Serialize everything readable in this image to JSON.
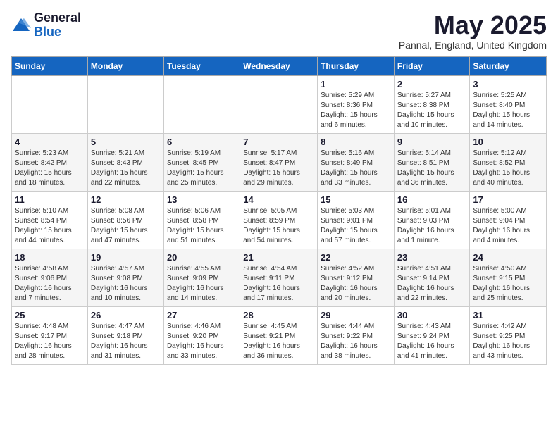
{
  "logo": {
    "general": "General",
    "blue": "Blue"
  },
  "header": {
    "month": "May 2025",
    "location": "Pannal, England, United Kingdom"
  },
  "weekdays": [
    "Sunday",
    "Monday",
    "Tuesday",
    "Wednesday",
    "Thursday",
    "Friday",
    "Saturday"
  ],
  "weeks": [
    [
      {
        "day": "",
        "info": ""
      },
      {
        "day": "",
        "info": ""
      },
      {
        "day": "",
        "info": ""
      },
      {
        "day": "",
        "info": ""
      },
      {
        "day": "1",
        "info": "Sunrise: 5:29 AM\nSunset: 8:36 PM\nDaylight: 15 hours\nand 6 minutes."
      },
      {
        "day": "2",
        "info": "Sunrise: 5:27 AM\nSunset: 8:38 PM\nDaylight: 15 hours\nand 10 minutes."
      },
      {
        "day": "3",
        "info": "Sunrise: 5:25 AM\nSunset: 8:40 PM\nDaylight: 15 hours\nand 14 minutes."
      }
    ],
    [
      {
        "day": "4",
        "info": "Sunrise: 5:23 AM\nSunset: 8:42 PM\nDaylight: 15 hours\nand 18 minutes."
      },
      {
        "day": "5",
        "info": "Sunrise: 5:21 AM\nSunset: 8:43 PM\nDaylight: 15 hours\nand 22 minutes."
      },
      {
        "day": "6",
        "info": "Sunrise: 5:19 AM\nSunset: 8:45 PM\nDaylight: 15 hours\nand 25 minutes."
      },
      {
        "day": "7",
        "info": "Sunrise: 5:17 AM\nSunset: 8:47 PM\nDaylight: 15 hours\nand 29 minutes."
      },
      {
        "day": "8",
        "info": "Sunrise: 5:16 AM\nSunset: 8:49 PM\nDaylight: 15 hours\nand 33 minutes."
      },
      {
        "day": "9",
        "info": "Sunrise: 5:14 AM\nSunset: 8:51 PM\nDaylight: 15 hours\nand 36 minutes."
      },
      {
        "day": "10",
        "info": "Sunrise: 5:12 AM\nSunset: 8:52 PM\nDaylight: 15 hours\nand 40 minutes."
      }
    ],
    [
      {
        "day": "11",
        "info": "Sunrise: 5:10 AM\nSunset: 8:54 PM\nDaylight: 15 hours\nand 44 minutes."
      },
      {
        "day": "12",
        "info": "Sunrise: 5:08 AM\nSunset: 8:56 PM\nDaylight: 15 hours\nand 47 minutes."
      },
      {
        "day": "13",
        "info": "Sunrise: 5:06 AM\nSunset: 8:58 PM\nDaylight: 15 hours\nand 51 minutes."
      },
      {
        "day": "14",
        "info": "Sunrise: 5:05 AM\nSunset: 8:59 PM\nDaylight: 15 hours\nand 54 minutes."
      },
      {
        "day": "15",
        "info": "Sunrise: 5:03 AM\nSunset: 9:01 PM\nDaylight: 15 hours\nand 57 minutes."
      },
      {
        "day": "16",
        "info": "Sunrise: 5:01 AM\nSunset: 9:03 PM\nDaylight: 16 hours\nand 1 minute."
      },
      {
        "day": "17",
        "info": "Sunrise: 5:00 AM\nSunset: 9:04 PM\nDaylight: 16 hours\nand 4 minutes."
      }
    ],
    [
      {
        "day": "18",
        "info": "Sunrise: 4:58 AM\nSunset: 9:06 PM\nDaylight: 16 hours\nand 7 minutes."
      },
      {
        "day": "19",
        "info": "Sunrise: 4:57 AM\nSunset: 9:08 PM\nDaylight: 16 hours\nand 10 minutes."
      },
      {
        "day": "20",
        "info": "Sunrise: 4:55 AM\nSunset: 9:09 PM\nDaylight: 16 hours\nand 14 minutes."
      },
      {
        "day": "21",
        "info": "Sunrise: 4:54 AM\nSunset: 9:11 PM\nDaylight: 16 hours\nand 17 minutes."
      },
      {
        "day": "22",
        "info": "Sunrise: 4:52 AM\nSunset: 9:12 PM\nDaylight: 16 hours\nand 20 minutes."
      },
      {
        "day": "23",
        "info": "Sunrise: 4:51 AM\nSunset: 9:14 PM\nDaylight: 16 hours\nand 22 minutes."
      },
      {
        "day": "24",
        "info": "Sunrise: 4:50 AM\nSunset: 9:15 PM\nDaylight: 16 hours\nand 25 minutes."
      }
    ],
    [
      {
        "day": "25",
        "info": "Sunrise: 4:48 AM\nSunset: 9:17 PM\nDaylight: 16 hours\nand 28 minutes."
      },
      {
        "day": "26",
        "info": "Sunrise: 4:47 AM\nSunset: 9:18 PM\nDaylight: 16 hours\nand 31 minutes."
      },
      {
        "day": "27",
        "info": "Sunrise: 4:46 AM\nSunset: 9:20 PM\nDaylight: 16 hours\nand 33 minutes."
      },
      {
        "day": "28",
        "info": "Sunrise: 4:45 AM\nSunset: 9:21 PM\nDaylight: 16 hours\nand 36 minutes."
      },
      {
        "day": "29",
        "info": "Sunrise: 4:44 AM\nSunset: 9:22 PM\nDaylight: 16 hours\nand 38 minutes."
      },
      {
        "day": "30",
        "info": "Sunrise: 4:43 AM\nSunset: 9:24 PM\nDaylight: 16 hours\nand 41 minutes."
      },
      {
        "day": "31",
        "info": "Sunrise: 4:42 AM\nSunset: 9:25 PM\nDaylight: 16 hours\nand 43 minutes."
      }
    ]
  ]
}
